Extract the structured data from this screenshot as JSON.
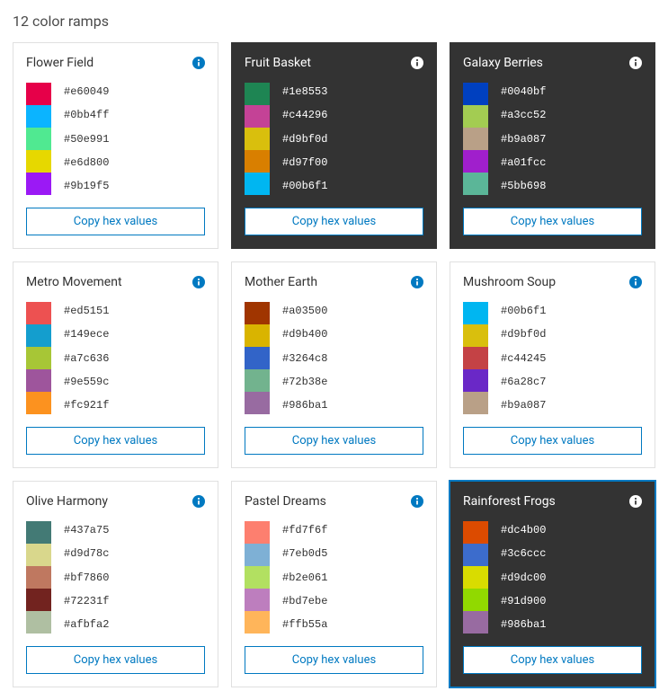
{
  "page_title": "12 color ramps",
  "copy_button_label": "Copy hex values",
  "ramps": [
    {
      "name": "Flower Field",
      "theme": "light",
      "selected": false,
      "hex": [
        "#e60049",
        "#0bb4ff",
        "#50e991",
        "#e6d800",
        "#9b19f5"
      ],
      "gradient": [
        "#e60049",
        "#0bb4ff",
        "#50e991",
        "#e6d800",
        "#9b19f5"
      ]
    },
    {
      "name": "Fruit Basket",
      "theme": "dark",
      "selected": false,
      "hex": [
        "#1e8553",
        "#c44296",
        "#d9bf0d",
        "#d97f00",
        "#00b6f1"
      ],
      "gradient": [
        "#1e8553",
        "#c44296",
        "#d9bf0d",
        "#d97f00",
        "#00b6f1"
      ]
    },
    {
      "name": "Galaxy Berries",
      "theme": "dark",
      "selected": false,
      "hex": [
        "#0040bf",
        "#a3cc52",
        "#b9a087",
        "#a01fcc",
        "#5bb698"
      ],
      "gradient": [
        "#0040bf",
        "#a3cc52",
        "#b9a087",
        "#a01fcc",
        "#5bb698"
      ]
    },
    {
      "name": "Metro Movement",
      "theme": "light",
      "selected": false,
      "hex": [
        "#ed5151",
        "#149ece",
        "#a7c636",
        "#9e559c",
        "#fc921f"
      ],
      "gradient": [
        "#ed5151",
        "#149ece",
        "#a7c636",
        "#9e559c",
        "#fc921f"
      ]
    },
    {
      "name": "Mother Earth",
      "theme": "light",
      "selected": false,
      "hex": [
        "#a03500",
        "#d9b400",
        "#3264c8",
        "#72b38e",
        "#986ba1"
      ],
      "gradient": [
        "#a03500",
        "#d9b400",
        "#3264c8",
        "#72b38e",
        "#986ba1"
      ]
    },
    {
      "name": "Mushroom Soup",
      "theme": "light",
      "selected": false,
      "hex": [
        "#00b6f1",
        "#d9bf0d",
        "#c44245",
        "#6a28c7",
        "#b9a087"
      ],
      "gradient": [
        "#00b6f1",
        "#d9bf0d",
        "#c44245",
        "#6a28c7",
        "#b9a087"
      ]
    },
    {
      "name": "Olive Harmony",
      "theme": "light",
      "selected": false,
      "hex": [
        "#437a75",
        "#d9d78c",
        "#bf7860",
        "#72231f",
        "#afbfa2"
      ],
      "gradient": [
        "#437a75",
        "#d9d78c",
        "#bf7860",
        "#72231f",
        "#afbfa2"
      ]
    },
    {
      "name": "Pastel Dreams",
      "theme": "light",
      "selected": false,
      "hex": [
        "#fd7f6f",
        "#7eb0d5",
        "#b2e061",
        "#bd7ebe",
        "#ffb55a"
      ],
      "gradient": [
        "#fd7f6f",
        "#7eb0d5",
        "#b2e061",
        "#bd7ebe",
        "#ffb55a"
      ]
    },
    {
      "name": "Rainforest Frogs",
      "theme": "dark",
      "selected": true,
      "hex": [
        "#dc4b00",
        "#3c6ccc",
        "#d9dc00",
        "#91d900",
        "#986ba1"
      ],
      "gradient": [
        "#dc4b00",
        "#3c6ccc",
        "#d9dc00",
        "#91d900",
        "#986ba1"
      ]
    }
  ]
}
